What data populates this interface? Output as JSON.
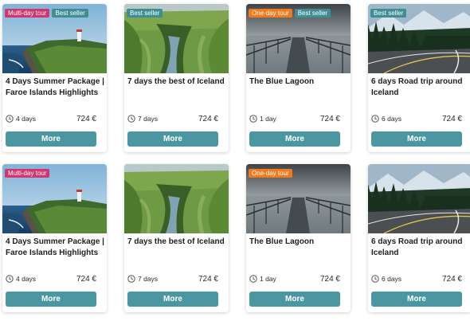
{
  "colors": {
    "multi_day_badge": "#d3356f",
    "best_seller_badge": "#3f8e96",
    "one_day_badge": "#f07a1c",
    "button": "#4a97a2"
  },
  "icons": {
    "duration": "clock-icon"
  },
  "rows": [
    {
      "cards": [
        {
          "image": "faroe-lighthouse-cliff",
          "badges": [
            {
              "label": "Multi-day tour",
              "color": "#d3356f"
            },
            {
              "label": "Best seller",
              "color": "#3f8e96"
            }
          ],
          "title": "4 Days Summer Package | Faroe Islands Highlights",
          "duration": "4 days",
          "price": "724 €",
          "button": "More"
        },
        {
          "image": "iceland-green-canyon",
          "badges": [
            {
              "label": "Best seller",
              "color": "#3f8e96"
            }
          ],
          "title": "7 days the best of Iceland",
          "duration": "7 days",
          "price": "724 €",
          "button": "More"
        },
        {
          "image": "blue-lagoon-walkway",
          "badges": [
            {
              "label": "One-day tour",
              "color": "#f07a1c"
            },
            {
              "label": "Best seller",
              "color": "#3f8e96"
            }
          ],
          "title": "The Blue Lagoon",
          "duration": "1 day",
          "price": "724 €",
          "button": "More"
        },
        {
          "image": "mountain-road-forest",
          "badges": [
            {
              "label": "Best seller",
              "color": "#3f8e96"
            }
          ],
          "title": "6 days Road trip around Iceland",
          "duration": "6 days",
          "price": "724 €",
          "button": "More"
        }
      ]
    },
    {
      "cards": [
        {
          "image": "faroe-lighthouse-cliff",
          "badges": [
            {
              "label": "Multi-day tour",
              "color": "#d3356f"
            }
          ],
          "title": "4 Days Summer Package | Faroe Islands Highlights",
          "duration": "4 days",
          "price": "724 €",
          "button": "More"
        },
        {
          "image": "iceland-green-canyon",
          "badges": [],
          "title": "7 days the best of Iceland",
          "duration": "7 days",
          "price": "724 €",
          "button": "More"
        },
        {
          "image": "blue-lagoon-walkway",
          "badges": [
            {
              "label": "One-day tour",
              "color": "#f07a1c"
            }
          ],
          "title": "The Blue Lagoon",
          "duration": "1 day",
          "price": "724 €",
          "button": "More"
        },
        {
          "image": "mountain-road-forest",
          "badges": [],
          "title": "6 days Road trip around Iceland",
          "duration": "6 days",
          "price": "724 €",
          "button": "More"
        }
      ]
    }
  ]
}
